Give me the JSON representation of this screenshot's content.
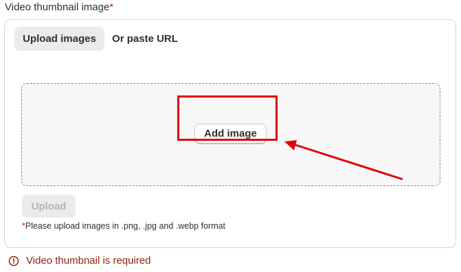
{
  "field": {
    "label": "Video thumbnail image",
    "required_mark": "*"
  },
  "tabs": [
    {
      "label": "Upload images",
      "active": true
    },
    {
      "label": "Or paste URL",
      "active": false
    }
  ],
  "dropzone": {
    "add_button_label": "Add image"
  },
  "upload_button_label": "Upload",
  "hint": {
    "required_mark": "*",
    "text": "Please upload images in .png, .jpg and .webp format"
  },
  "error": {
    "icon": "alert-circle-icon",
    "message": "Video thumbnail is required"
  },
  "annotation": {
    "color": "#e0000a"
  },
  "colors": {
    "error_text": "#8e1f0b",
    "required": "#e51c00",
    "tab_active_bg": "#ebebeb"
  }
}
